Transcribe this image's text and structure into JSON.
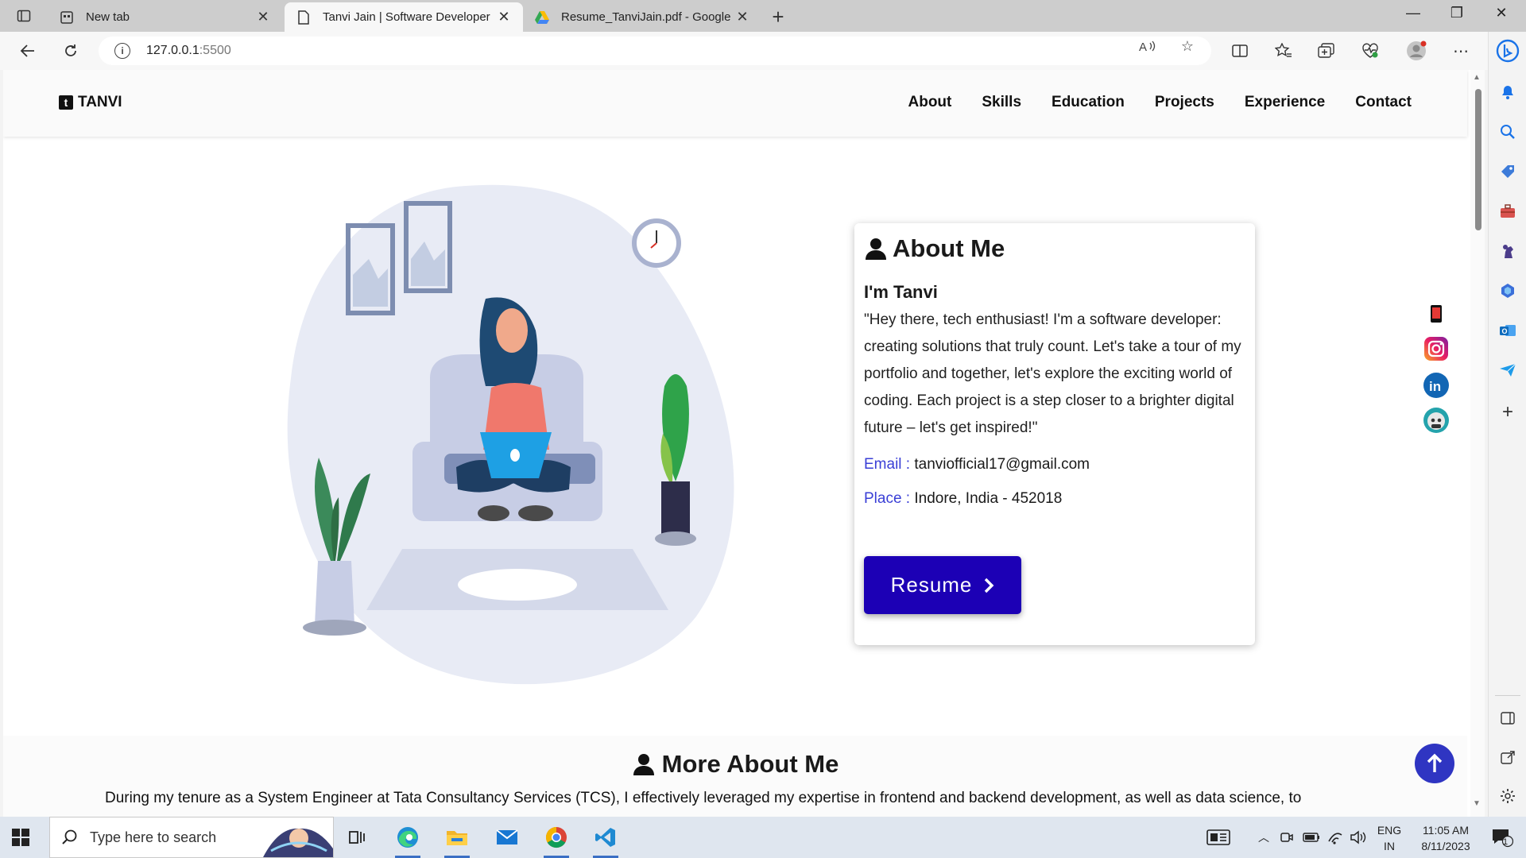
{
  "browser": {
    "tabs": [
      {
        "title": "New tab",
        "icon": "newtab-icon",
        "active": false
      },
      {
        "title": "Tanvi Jain | Software Developer",
        "icon": "page-icon",
        "active": true
      },
      {
        "title": "Resume_TanviJain.pdf - Google D",
        "icon": "google-drive-icon",
        "active": false
      }
    ],
    "address": {
      "host": "127.0.0.1",
      "port": ":5500"
    }
  },
  "site": {
    "logo_text": "TANVI",
    "nav": [
      "About",
      "Skills",
      "Education",
      "Projects",
      "Experience",
      "Contact"
    ],
    "about": {
      "heading": "About Me",
      "greeting": "I'm Tanvi",
      "intro": "\"Hey there, tech enthusiast! I'm a software developer: creating solutions that truly count. Let's take a tour of my portfolio and together, let's explore the exciting world of coding. Each project is a step closer to a brighter digital future – let's get inspired!\"",
      "email_label": "Email :",
      "email_value": "tanviofficial17@gmail.com",
      "place_label": "Place :",
      "place_value": "Indore, India - 452018",
      "resume_button": "Resume"
    },
    "more": {
      "heading": "More About Me",
      "text": "During my tenure as a System Engineer at Tata Consultancy Services (TCS), I effectively leveraged my expertise in frontend and backend development, as well as data science, to"
    },
    "social_icons": [
      "mobile-icon",
      "instagram-icon",
      "linkedin-icon",
      "github-icon"
    ]
  },
  "taskbar": {
    "search_placeholder": "Type here to search",
    "lang_top": "ENG",
    "lang_bottom": "IN",
    "time": "11:05 AM",
    "date": "8/11/2023",
    "notification_count": "1"
  },
  "colors": {
    "accent": "#1c00b5",
    "link_label": "#3a3fd6",
    "to_top": "#2f35c2"
  }
}
